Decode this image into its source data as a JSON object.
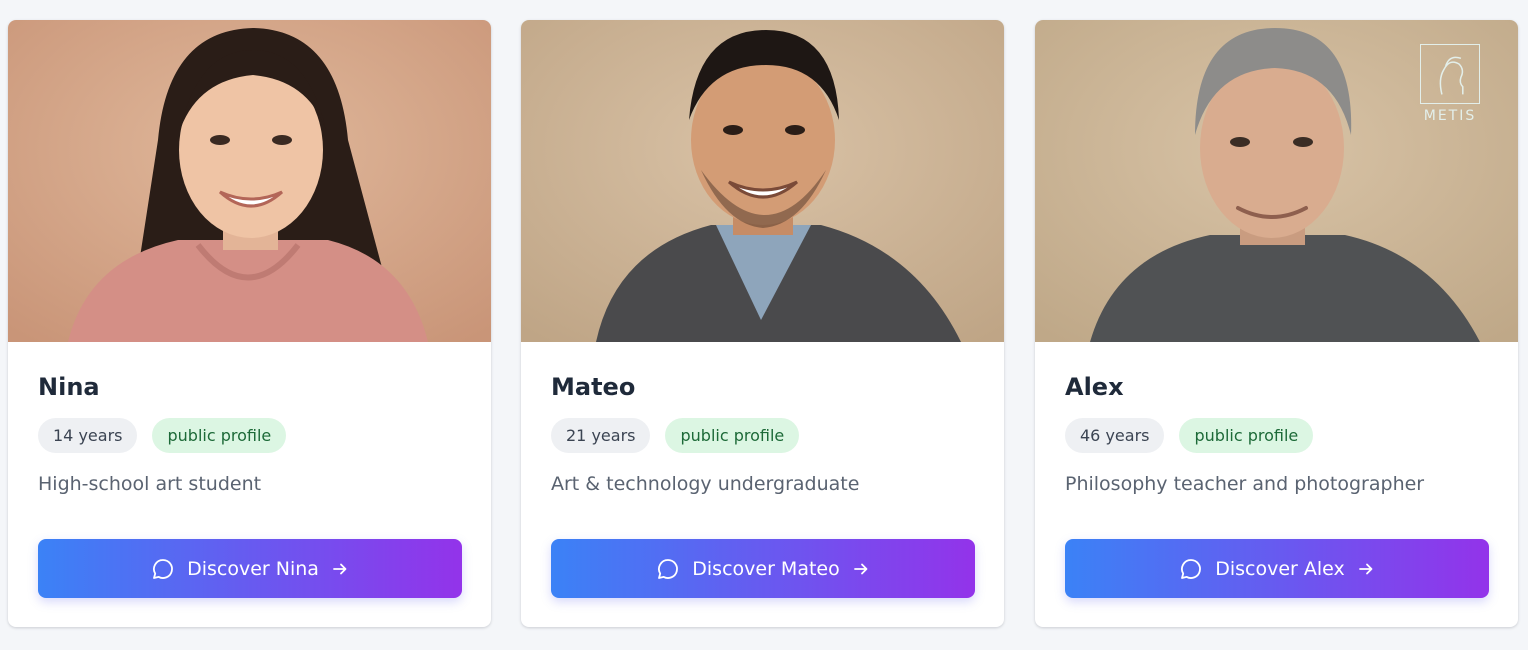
{
  "profiles": [
    {
      "name": "Nina",
      "age": "14 years",
      "visibility": "public profile",
      "description": "High-school art student",
      "button_label": "Discover Nina"
    },
    {
      "name": "Mateo",
      "age": "21 years",
      "visibility": "public profile",
      "description": "Art & technology undergraduate",
      "button_label": "Discover Mateo"
    },
    {
      "name": "Alex",
      "age": "46 years",
      "visibility": "public profile",
      "description": "Philosophy teacher and photographer",
      "button_label": "Discover Alex"
    }
  ],
  "watermark": {
    "text": "METIS",
    "icon": "woman-profile-logo-icon"
  },
  "icons": {
    "button_leading": "chat-bubble-icon",
    "button_trailing": "arrow-right-icon"
  },
  "colors": {
    "gradient_start": "#3b82f6",
    "gradient_end": "#9333ea",
    "public_badge_bg": "#dcf6e3",
    "public_badge_text": "#1d6a38",
    "age_badge_bg": "#eef0f3"
  }
}
